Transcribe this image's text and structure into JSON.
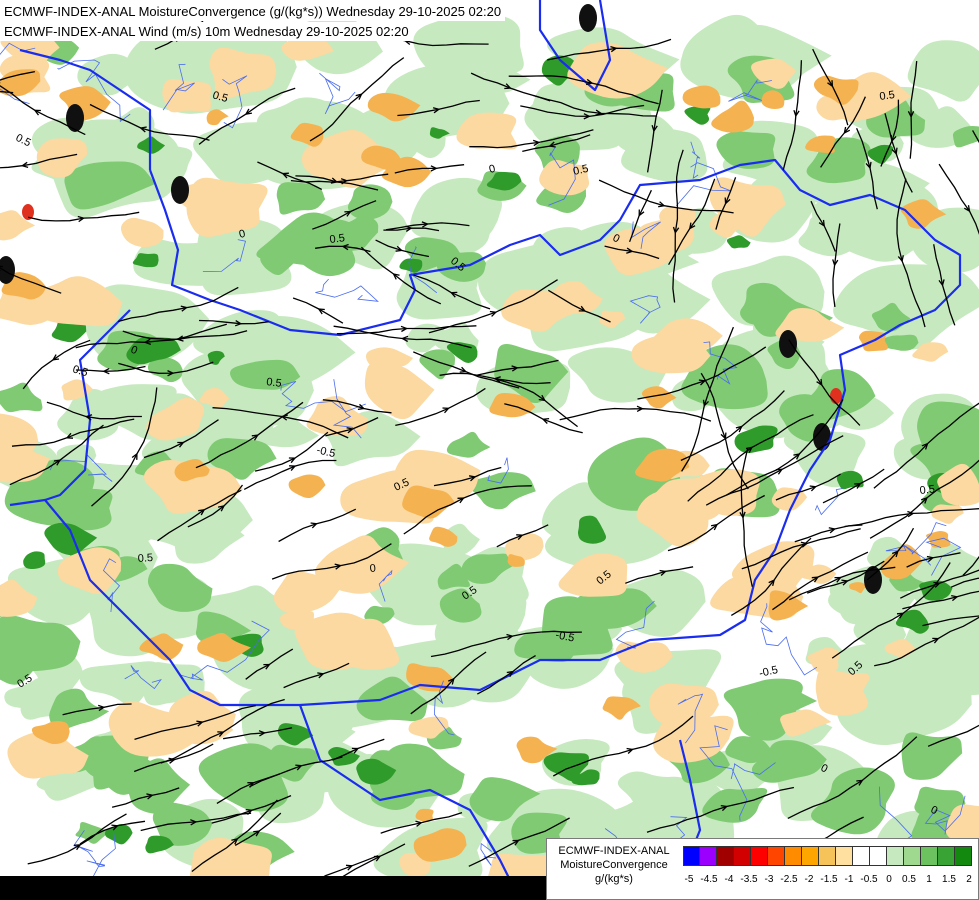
{
  "titles": {
    "line1": "ECMWF-INDEX-ANAL MoistureConvergence (g/(kg*s)) Wednesday 29-10-2025 02:20",
    "line2": "ECMWF-INDEX-ANAL Wind (m/s) 10m Wednesday 29-10-2025 02:20"
  },
  "legend": {
    "title_lines": [
      "ECMWF-INDEX-ANAL",
      "MoistureConvergence",
      "g/(kg*s)"
    ],
    "colors": [
      "#0000ff",
      "#9b00ff",
      "#a00000",
      "#d20000",
      "#ff0000",
      "#ff4500",
      "#ff8c00",
      "#ffa500",
      "#f6c25a",
      "#ffe0a0",
      "#ffffff",
      "#ffffff",
      "#c6e9bf",
      "#9fd98f",
      "#6cc25e",
      "#3aa335",
      "#138a0f"
    ],
    "tick_labels": [
      "-5",
      "-4.5",
      "-4",
      "-3.5",
      "-3",
      "-2.5",
      "-2",
      "-1.5",
      "-1",
      "-0.5",
      "0",
      "0.5",
      "1",
      "1.5",
      "2"
    ]
  },
  "map": {
    "contour_labels": [
      "0.5",
      "0.5",
      "0",
      "0.5",
      "0.5",
      "0",
      "0.5",
      "0",
      "0.5",
      "-0.5",
      "0.5",
      "0",
      "0.5",
      "0.5",
      "-0.5",
      "0.5",
      "0",
      "0.5",
      "-0.5",
      "0.5",
      "0",
      "0.5",
      "0.5",
      "0",
      "0.5"
    ],
    "colors": {
      "green_light": "#c6e9bf",
      "green_mid": "#7fca73",
      "green_dark": "#2f9b2a",
      "orange_light": "#fbd9a0",
      "orange_mid": "#f5b250",
      "black_core": "#101010",
      "red_core": "#e0301e",
      "border_blue": "#1a2cf0",
      "river_blue": "#4a6cf0",
      "streamline": "#000000"
    }
  }
}
